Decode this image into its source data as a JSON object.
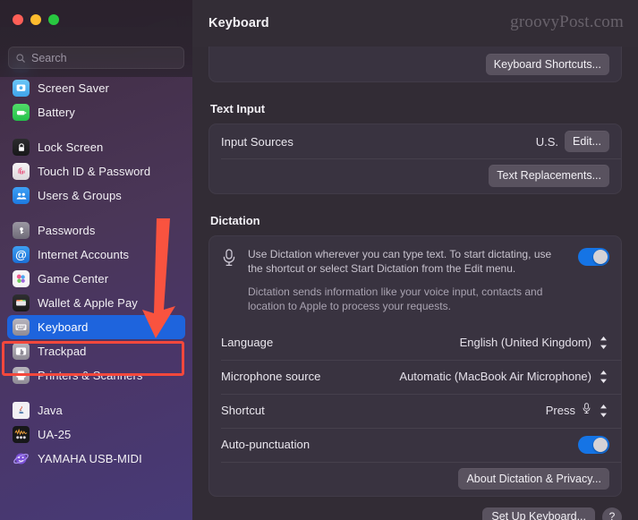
{
  "window": {
    "traffic_lights": [
      "close",
      "minimize",
      "zoom"
    ],
    "colors": {
      "close": "#ff5f57",
      "minimize": "#febc2e",
      "zoom": "#28c840",
      "selection_blue": "#1e64dd",
      "toggle_on": "#1574e5",
      "annotation_red": "#f4483c"
    }
  },
  "sidebar": {
    "search": {
      "placeholder": "Search",
      "value": "",
      "icon": "search-icon"
    },
    "items": [
      {
        "label": "Screen Saver",
        "icon": "screen-saver-icon",
        "selected": false
      },
      {
        "label": "Battery",
        "icon": "battery-icon",
        "selected": false
      },
      {
        "label": "Lock Screen",
        "icon": "lock-screen-icon",
        "selected": false
      },
      {
        "label": "Touch ID & Password",
        "icon": "touch-id-icon",
        "selected": false
      },
      {
        "label": "Users & Groups",
        "icon": "users-groups-icon",
        "selected": false
      },
      {
        "label": "Passwords",
        "icon": "passwords-icon",
        "selected": false
      },
      {
        "label": "Internet Accounts",
        "icon": "internet-accounts-icon",
        "selected": false
      },
      {
        "label": "Game Center",
        "icon": "game-center-icon",
        "selected": false
      },
      {
        "label": "Wallet & Apple Pay",
        "icon": "wallet-icon",
        "selected": false
      },
      {
        "label": "Keyboard",
        "icon": "keyboard-icon",
        "selected": true
      },
      {
        "label": "Trackpad",
        "icon": "trackpad-icon",
        "selected": false
      },
      {
        "label": "Printers & Scanners",
        "icon": "printers-scanners-icon",
        "selected": false
      },
      {
        "label": "Java",
        "icon": "java-icon",
        "selected": false
      },
      {
        "label": "UA-25",
        "icon": "ua25-icon",
        "selected": false
      },
      {
        "label": "YAMAHA USB-MIDI",
        "icon": "yamaha-usb-midi-icon",
        "selected": false
      }
    ]
  },
  "header": {
    "title": "Keyboard",
    "watermark": "groovyPost.com"
  },
  "main": {
    "top_card": {
      "shortcuts_button": "Keyboard Shortcuts..."
    },
    "text_input": {
      "section_title": "Text Input",
      "input_sources_label": "Input Sources",
      "input_sources_value": "U.S.",
      "edit_button": "Edit...",
      "text_replacements_button": "Text Replacements..."
    },
    "dictation": {
      "section_title": "Dictation",
      "mic_icon": "microphone-icon",
      "description_primary": "Use Dictation wherever you can type text. To start dictating, use the shortcut or select Start Dictation from the Edit menu.",
      "description_secondary": "Dictation sends information like your voice input, contacts and location to Apple to process your requests.",
      "dictation_toggle": "on",
      "rows": [
        {
          "label": "Language",
          "value": "English (United Kingdom)",
          "control": "stepper"
        },
        {
          "label": "Microphone source",
          "value": "Automatic (MacBook Air Microphone)",
          "control": "stepper"
        },
        {
          "label": "Shortcut",
          "value": "Press",
          "control": "stepper",
          "extra_icon": "microphone-icon"
        }
      ],
      "auto_punctuation_label": "Auto-punctuation",
      "auto_punctuation_toggle": "on",
      "about_button": "About Dictation & Privacy..."
    },
    "bottom_partial": {
      "button_label": "Set Up Keyboard...",
      "help_label": "?"
    }
  },
  "annotations": {
    "arrow": "red-down-arrow pointing to Keyboard",
    "highlight": "red-rectangle around Keyboard item"
  }
}
